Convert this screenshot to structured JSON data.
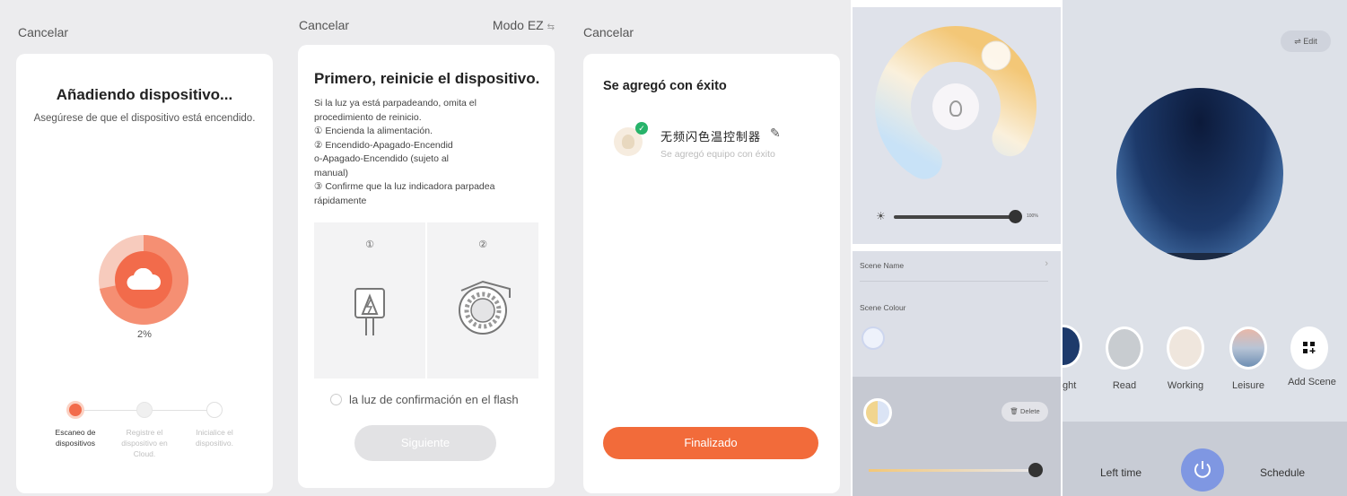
{
  "screen1": {
    "cancel": "Cancelar",
    "title": "Añadiendo dispositivo...",
    "subtitle": "Asegúrese de que el dispositivo está encendido.",
    "progress": "2%",
    "progress_value": 0.02,
    "steps": [
      {
        "label": "Escaneo de dispositivos",
        "state": "active"
      },
      {
        "label": "Registre el dispositivo en Cloud.",
        "state": "pending"
      },
      {
        "label": "Inicialice el dispositivo.",
        "state": "pending"
      }
    ],
    "accent": "#f26b4b"
  },
  "screen2": {
    "cancel": "Cancelar",
    "mode": "Modo EZ",
    "mode_icon": "swap-icon",
    "title": "Primero, reinicie el dispositivo.",
    "lines": [
      "Si la luz ya está parpadeando, omita el",
      "procedimiento de reinicio.",
      "① Encienda la alimentación.",
      "② Encendido-Apagado-Encendid",
      "o-Apagado-Encendido (sujeto al",
      "manual)",
      "③ Confirme que la luz indicadora parpadea",
      "rápidamente"
    ],
    "step_badges": [
      "①",
      "②"
    ],
    "confirm": "la luz de confirmación en el flash",
    "next": "Siguiente"
  },
  "screen3": {
    "cancel": "Cancelar",
    "title": "Se agregó con éxito",
    "device_name": "无频闪色温控制器",
    "device_status": "Se agregó equipo con éxito",
    "done": "Finalizado",
    "accent": "#f26b3a"
  },
  "screen4": {
    "brightness_value": "100%",
    "brightness_level": 1.0,
    "scene_name_label": "Scene Name",
    "scene_colour_label": "Scene Colour",
    "delete": "Delete"
  },
  "screen5": {
    "edit": "Edit",
    "scenes": [
      {
        "label": "ght"
      },
      {
        "label": "Read"
      },
      {
        "label": "Working"
      },
      {
        "label": "Leisure"
      },
      {
        "label": "Add Scene"
      }
    ],
    "left_time": "Left time",
    "schedule": "Schedule",
    "power_color": "#7f97e2"
  }
}
